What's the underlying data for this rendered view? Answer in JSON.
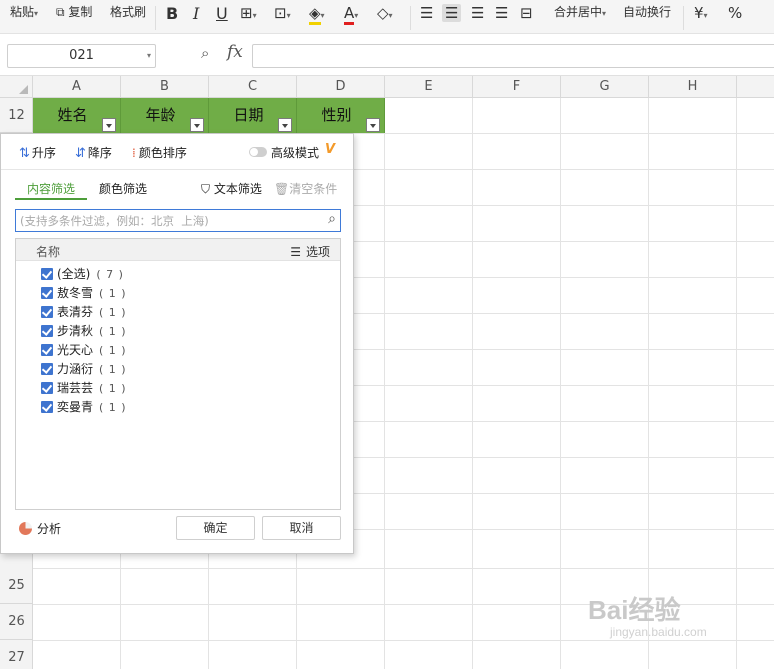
{
  "toolbar": {
    "paste": "粘贴",
    "copy": "复制",
    "format_painter": "格式刷",
    "merge_center": "合并居中",
    "wrap_text": "自动换行",
    "currency_symbol": "¥",
    "percent_symbol": "%",
    "bold": "B",
    "italic": "I",
    "underline": "U"
  },
  "formula_bar": {
    "name_box": "021",
    "fx": "fx",
    "formula": ""
  },
  "columns": [
    "A",
    "B",
    "C",
    "D",
    "E",
    "F",
    "G",
    "H"
  ],
  "rows": {
    "top": "12",
    "bottom": [
      "25",
      "26",
      "27"
    ]
  },
  "table_header": {
    "cells": [
      "姓名",
      "年龄",
      "日期",
      "性别"
    ]
  },
  "header_fill_color": "#70ad47",
  "filter_popup": {
    "sort_asc": "升序",
    "sort_desc": "降序",
    "color_sort": "颜色排序",
    "advanced_mode": "高级模式",
    "tab_content": "内容筛选",
    "tab_color": "颜色筛选",
    "text_filter": "文本筛选",
    "clear_conditions": "清空条件",
    "search_placeholder": "(支持多条件过滤，例如：北京  上海)",
    "list_header": "名称",
    "options": "选项",
    "items": [
      {
        "label": "(全选)",
        "count": "( 7 )"
      },
      {
        "label": "敖冬雪",
        "count": "( 1 )"
      },
      {
        "label": "表清芬",
        "count": "( 1 )"
      },
      {
        "label": "步清秋",
        "count": "( 1 )"
      },
      {
        "label": "光天心",
        "count": "( 1 )"
      },
      {
        "label": "力涵衍",
        "count": "( 1 )"
      },
      {
        "label": "瑞芸芸",
        "count": "( 1 )"
      },
      {
        "label": "奕曼青",
        "count": "( 1 )"
      }
    ],
    "analysis": "分析",
    "ok": "确定",
    "cancel": "取消",
    "accent_color": "#4d9e3a",
    "checkbox_color": "#3e74cf"
  },
  "watermark": {
    "brand": "Bai经验",
    "url": "jingyan.baidu.com"
  }
}
